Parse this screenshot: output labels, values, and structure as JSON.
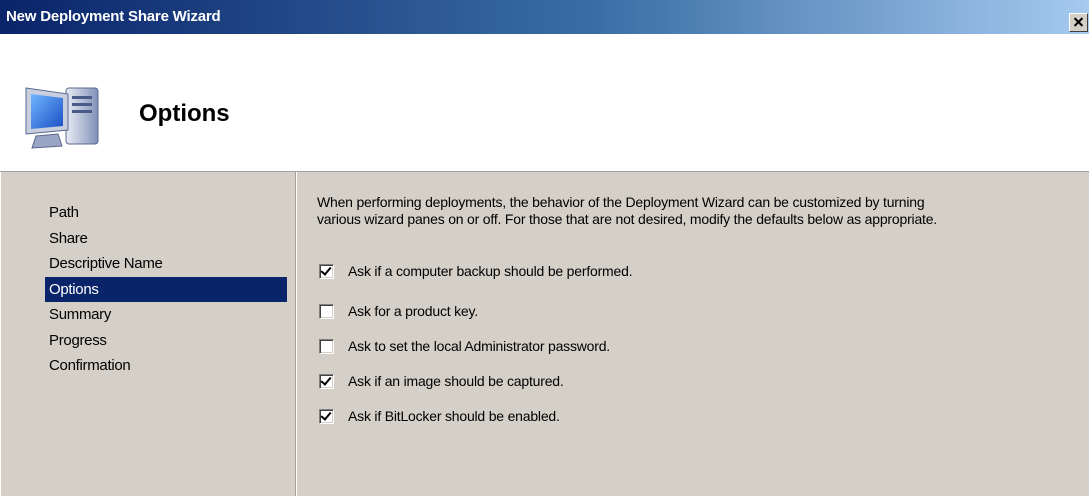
{
  "window": {
    "title": "New Deployment Share Wizard",
    "close_icon": "close-icon"
  },
  "header": {
    "title": "Options",
    "icon": "computer-icon"
  },
  "nav": {
    "items": [
      {
        "label": "Path",
        "active": false
      },
      {
        "label": "Share",
        "active": false
      },
      {
        "label": "Descriptive Name",
        "active": false
      },
      {
        "label": "Options",
        "active": true
      },
      {
        "label": "Summary",
        "active": false
      },
      {
        "label": "Progress",
        "active": false
      },
      {
        "label": "Confirmation",
        "active": false
      }
    ]
  },
  "content": {
    "description_line1": "When performing deployments, the behavior of the Deployment Wizard can be customized by turning",
    "description_line2": "various wizard panes on or off.  For those that are not desired, modify the defaults below as appropriate.",
    "options": [
      {
        "label": "Ask if a computer backup should be performed.",
        "checked": true
      },
      {
        "label": "Ask for a product key.",
        "checked": false
      },
      {
        "label": "Ask to set the local Administrator password.",
        "checked": false
      },
      {
        "label": "Ask if an image should be captured.",
        "checked": true
      },
      {
        "label": "Ask if BitLocker should be enabled.",
        "checked": true
      }
    ]
  },
  "colors": {
    "titlebar_start": "#0a246a",
    "titlebar_end": "#a6caf0",
    "selection": "#0a246a",
    "panel": "#d4d0c8"
  }
}
